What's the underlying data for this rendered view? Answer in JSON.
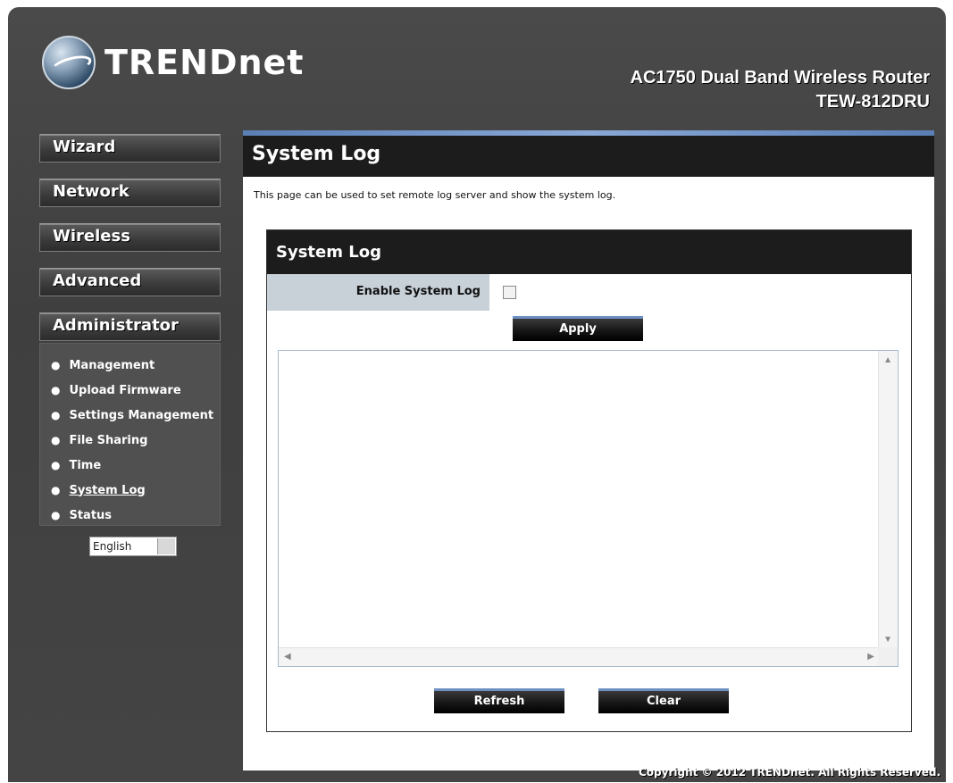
{
  "brand": {
    "name": "TRENDnet"
  },
  "product": {
    "name": "AC1750 Dual Band Wireless Router",
    "model": "TEW-812DRU"
  },
  "nav": {
    "wizard": "Wizard",
    "network": "Network",
    "wireless": "Wireless",
    "advanced": "Advanced",
    "administrator": "Administrator"
  },
  "submenu": {
    "items": [
      {
        "label": "Management"
      },
      {
        "label": "Upload Firmware"
      },
      {
        "label": "Settings Management"
      },
      {
        "label": "File Sharing"
      },
      {
        "label": "Time"
      },
      {
        "label": "System Log"
      },
      {
        "label": "Status"
      }
    ],
    "active": "System Log"
  },
  "language": {
    "selected": "English"
  },
  "page": {
    "title": "System Log",
    "description": "This page can be used to set remote log server and show the system log."
  },
  "section": {
    "title": "System Log",
    "enable_label": "Enable System Log",
    "enable_checked": false,
    "apply_label": "Apply",
    "log_text": "",
    "refresh_label": "Refresh",
    "clear_label": "Clear"
  },
  "footer": {
    "copyright": "Copyright © 2012 TRENDnet. All Rights Reserved."
  },
  "colors": {
    "accent": "#6d8fc2",
    "header_bg": "#1c1c1c",
    "sidebar_bg": "#3f3f3f",
    "label_bg": "#c8d0d8"
  }
}
